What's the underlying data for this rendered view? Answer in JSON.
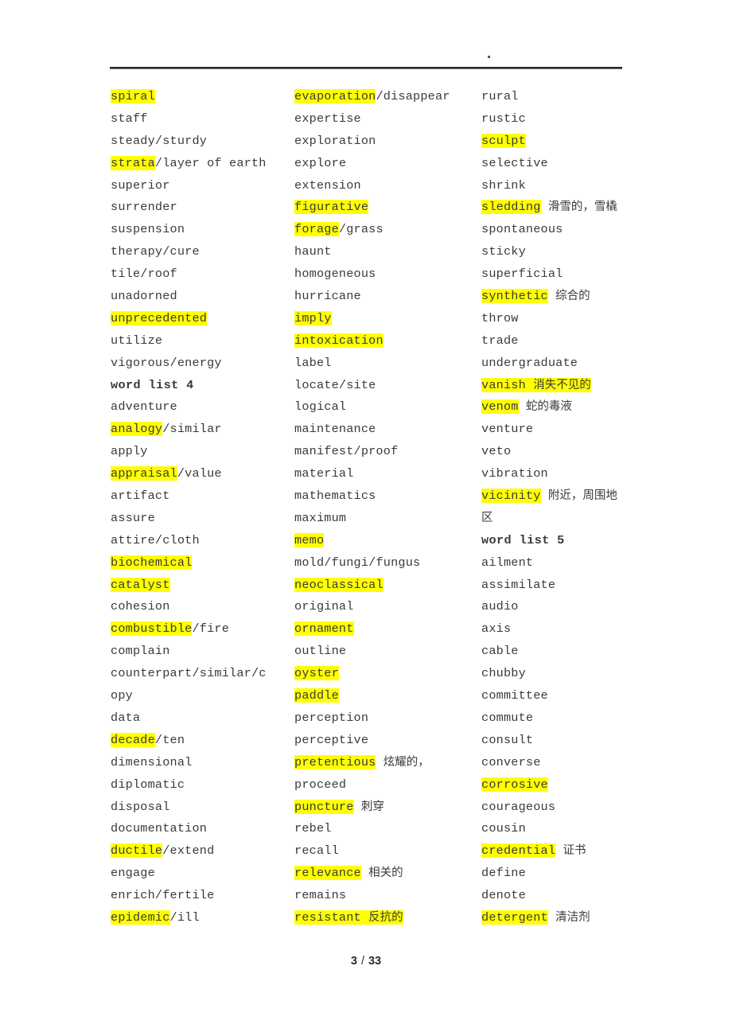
{
  "document": {
    "header_mark": ".",
    "footer": {
      "current_page": "3",
      "separator": "/",
      "total_pages": "33"
    }
  },
  "columns": [
    {
      "id": "column-1",
      "entries": [
        {
          "word": "spiral",
          "highlight": "word"
        },
        {
          "word": "staff",
          "highlight": "none"
        },
        {
          "word": "steady/sturdy",
          "highlight": "none"
        },
        {
          "word": "strata",
          "rest": "/layer of earth",
          "highlight": "word"
        },
        {
          "word": "superior",
          "highlight": "none"
        },
        {
          "word": "surrender",
          "highlight": "none"
        },
        {
          "word": "suspension",
          "highlight": "none"
        },
        {
          "word": "therapy/cure",
          "highlight": "none"
        },
        {
          "word": "tile/roof",
          "highlight": "none"
        },
        {
          "word": "unadorned",
          "highlight": "none"
        },
        {
          "word": "unprecedented",
          "highlight": "word"
        },
        {
          "word": "utilize",
          "highlight": "none"
        },
        {
          "word": "vigorous/energy",
          "highlight": "none"
        },
        {
          "word": "word list 4",
          "highlight": "none",
          "bold": true
        },
        {
          "word": "adventure",
          "highlight": "none"
        },
        {
          "word": "analogy",
          "rest": "/similar",
          "highlight": "word"
        },
        {
          "word": "apply",
          "highlight": "none"
        },
        {
          "word": "appraisal",
          "rest": "/value",
          "highlight": "word"
        },
        {
          "word": "artifact",
          "highlight": "none"
        },
        {
          "word": "assure",
          "highlight": "none"
        },
        {
          "word": "attire/cloth",
          "highlight": "none"
        },
        {
          "word": "biochemical",
          "highlight": "word"
        },
        {
          "word": "catalyst",
          "highlight": "word"
        },
        {
          "word": "cohesion",
          "highlight": "none"
        },
        {
          "word": "combustible",
          "rest": "/fire",
          "highlight": "word"
        },
        {
          "word": "complain",
          "highlight": "none"
        },
        {
          "word": "counterpart/similar/c",
          "highlight": "none"
        },
        {
          "word": "opy",
          "highlight": "none"
        },
        {
          "word": "data",
          "highlight": "none"
        },
        {
          "word": "decade",
          "rest": "/ten",
          "highlight": "word"
        },
        {
          "word": "dimensional",
          "highlight": "none"
        },
        {
          "word": "diplomatic",
          "highlight": "none"
        },
        {
          "word": "disposal",
          "highlight": "none"
        },
        {
          "word": "documentation",
          "highlight": "none"
        },
        {
          "word": "ductile",
          "rest": "/extend",
          "highlight": "word"
        },
        {
          "word": "engage",
          "highlight": "none"
        },
        {
          "word": "enrich/fertile",
          "highlight": "none"
        },
        {
          "word": "epidemic",
          "rest": "/ill",
          "highlight": "word"
        }
      ]
    },
    {
      "id": "column-2",
      "entries": [
        {
          "word": "evaporation",
          "rest": "/disappear",
          "highlight": "word"
        },
        {
          "word": "expertise",
          "highlight": "none"
        },
        {
          "word": "exploration",
          "highlight": "none"
        },
        {
          "word": "explore",
          "highlight": "none"
        },
        {
          "word": "extension",
          "highlight": "none"
        },
        {
          "word": "figurative",
          "highlight": "word"
        },
        {
          "word": "forage",
          "rest": "/grass",
          "highlight": "word"
        },
        {
          "word": "haunt",
          "highlight": "none"
        },
        {
          "word": "homogeneous",
          "highlight": "none"
        },
        {
          "word": "hurricane",
          "highlight": "none"
        },
        {
          "word": "imply",
          "highlight": "word"
        },
        {
          "word": "intoxication",
          "highlight": "word"
        },
        {
          "word": "label",
          "highlight": "none"
        },
        {
          "word": "locate/site",
          "highlight": "none"
        },
        {
          "word": "logical",
          "highlight": "none"
        },
        {
          "word": "maintenance",
          "highlight": "none"
        },
        {
          "word": "manifest/proof",
          "highlight": "none"
        },
        {
          "word": "material",
          "highlight": "none"
        },
        {
          "word": "mathematics",
          "highlight": "none"
        },
        {
          "word": "maximum",
          "highlight": "none"
        },
        {
          "word": "memo",
          "highlight": "word"
        },
        {
          "word": "mold/fungi/fungus",
          "highlight": "none"
        },
        {
          "word": "neoclassical",
          "highlight": "word"
        },
        {
          "word": "original",
          "highlight": "none"
        },
        {
          "word": "ornament",
          "highlight": "word"
        },
        {
          "word": "outline",
          "highlight": "none"
        },
        {
          "word": "oyster",
          "highlight": "word"
        },
        {
          "word": "paddle",
          "highlight": "word"
        },
        {
          "word": "perception",
          "highlight": "none"
        },
        {
          "word": "perceptive",
          "highlight": "none"
        },
        {
          "word": "pretentious",
          "cn": "炫耀的，",
          "highlight": "word"
        },
        {
          "word": "proceed",
          "highlight": "none"
        },
        {
          "word": "puncture",
          "cn": "刺穿",
          "highlight": "word"
        },
        {
          "word": "rebel",
          "highlight": "none"
        },
        {
          "word": "recall",
          "highlight": "none"
        },
        {
          "word": "relevance",
          "cn": "相关的",
          "highlight": "word"
        },
        {
          "word": "remains",
          "highlight": "none"
        },
        {
          "word": "resistant",
          "cn": "反抗的",
          "highlight": "all"
        }
      ]
    },
    {
      "id": "column-3",
      "entries": [
        {
          "word": "rural",
          "highlight": "none"
        },
        {
          "word": "rustic",
          "highlight": "none"
        },
        {
          "word": "sculpt",
          "highlight": "word"
        },
        {
          "word": "selective",
          "highlight": "none"
        },
        {
          "word": "shrink",
          "highlight": "none"
        },
        {
          "word": "sledding",
          "cn": "滑雪的，雪橇",
          "highlight": "word"
        },
        {
          "word": "spontaneous",
          "highlight": "none"
        },
        {
          "word": "sticky",
          "highlight": "none"
        },
        {
          "word": "superficial",
          "highlight": "none"
        },
        {
          "word": "synthetic",
          "cn": "综合的",
          "highlight": "word"
        },
        {
          "word": "throw",
          "highlight": "none"
        },
        {
          "word": "trade",
          "highlight": "none"
        },
        {
          "word": "undergraduate",
          "highlight": "none"
        },
        {
          "word": "vanish",
          "cn": "消失不见的",
          "highlight": "all"
        },
        {
          "word": "venom",
          "cn": "蛇的毒液",
          "highlight": "word"
        },
        {
          "word": "venture",
          "highlight": "none"
        },
        {
          "word": "veto",
          "highlight": "none"
        },
        {
          "word": "vibration",
          "highlight": "none"
        },
        {
          "word": "vicinity",
          "cn": "附近，周围地",
          "highlight": "word"
        },
        {
          "word": "区",
          "highlight": "none",
          "cn_only": true
        },
        {
          "word": "word list 5",
          "highlight": "none",
          "bold": true
        },
        {
          "word": "ailment",
          "highlight": "none"
        },
        {
          "word": "assimilate",
          "highlight": "none"
        },
        {
          "word": "audio",
          "highlight": "none"
        },
        {
          "word": "axis",
          "highlight": "none"
        },
        {
          "word": "cable",
          "highlight": "none"
        },
        {
          "word": "chubby",
          "highlight": "none"
        },
        {
          "word": "committee",
          "highlight": "none"
        },
        {
          "word": "commute",
          "highlight": "none"
        },
        {
          "word": "consult",
          "highlight": "none"
        },
        {
          "word": "converse",
          "highlight": "none"
        },
        {
          "word": "corrosive",
          "highlight": "word"
        },
        {
          "word": "courageous",
          "highlight": "none"
        },
        {
          "word": "cousin",
          "highlight": "none"
        },
        {
          "word": "credential",
          "cn": "证书",
          "highlight": "word"
        },
        {
          "word": "define",
          "highlight": "none"
        },
        {
          "word": "denote",
          "highlight": "none"
        },
        {
          "word": "detergent",
          "cn": "清洁剂",
          "highlight": "word"
        }
      ]
    }
  ],
  "colors": {
    "highlight": "#ffff00",
    "text": "#3a3a3a",
    "rule": "#2b2b2b"
  }
}
